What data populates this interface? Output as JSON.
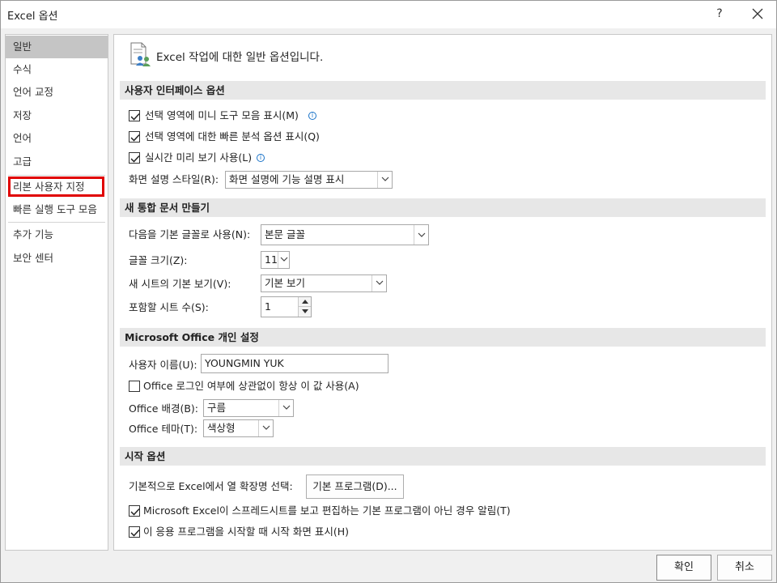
{
  "window": {
    "title": "Excel 옵션",
    "help": "?"
  },
  "sidebar": {
    "items": [
      {
        "label": "일반"
      },
      {
        "label": "수식"
      },
      {
        "label": "언어 교정"
      },
      {
        "label": "저장"
      },
      {
        "label": "언어"
      },
      {
        "label": "고급"
      },
      {
        "label": "리본 사용자 지정"
      },
      {
        "label": "빠른 실행 도구 모음"
      },
      {
        "label": "추가 기능"
      },
      {
        "label": "보안 센터"
      }
    ],
    "selected": "일반",
    "highlighted": "리본 사용자 지정",
    "highlight_color": "#e00000"
  },
  "main": {
    "header_text": "Excel 작업에 대한 일반 옵션입니다.",
    "ui_options": {
      "heading": "사용자 인터페이스 옵션",
      "mini_toolbar": "선택 영역에 미니 도구 모음 표시(M)",
      "quick_analysis": "선택 영역에 대한 빠른 분석 옵션 표시(Q)",
      "live_preview": "실시간 미리 보기 사용(L)",
      "screentip_label": "화면 설명 스타일(R):",
      "screentip_value": "화면 설명에 기능 설명 표시"
    },
    "new_workbook": {
      "heading": "새 통합 문서 만들기",
      "font_label": "다음을 기본 글꼴로 사용(N):",
      "font_value": "본문 글꼴",
      "size_label": "글꼴 크기(Z):",
      "size_value": "11",
      "view_label": "새 시트의 기본 보기(V):",
      "view_value": "기본 보기",
      "sheets_label": "포함할 시트 수(S):",
      "sheets_value": "1"
    },
    "personalize": {
      "heading": "Microsoft Office 개인 설정",
      "username_label": "사용자 이름(U):",
      "username_value": "YOUNGMIN YUK",
      "always_use": "Office 로그인 여부에 상관없이 항상 이 값 사용(A)",
      "background_label": "Office 배경(B):",
      "background_value": "구름",
      "theme_label": "Office 테마(T):",
      "theme_value": "색상형"
    },
    "startup": {
      "heading": "시작 옵션",
      "ext_label": "기본적으로 Excel에서 열 확장명 선택:",
      "default_programs_button": "기본 프로그램(D)...",
      "tell_me": "Microsoft Excel이 스프레드시트를 보고 편집하는 기본 프로그램이 아닌 경우 알림(T)",
      "show_start": "이 응용 프로그램을 시작할 때 시작 화면 표시(H)"
    }
  },
  "checkboxes": {
    "mini_toolbar": true,
    "quick_analysis": true,
    "live_preview": true,
    "always_use": false,
    "tell_me": true,
    "show_start": true
  },
  "footer": {
    "ok": "확인",
    "cancel": "취소"
  }
}
